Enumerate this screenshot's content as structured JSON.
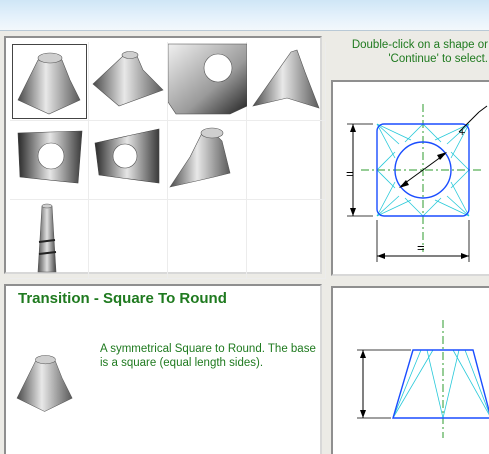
{
  "hint": {
    "line1": "Double-click on a shape or",
    "line2": "'Continue' to select."
  },
  "shapes": [
    {
      "name": "square-to-round",
      "selected": true
    },
    {
      "name": "rectangle-to-round",
      "selected": false
    },
    {
      "name": "square-plate-with-hole",
      "selected": false
    },
    {
      "name": "offset-transition",
      "selected": false
    },
    {
      "name": "rectangle-plate-with-hole",
      "selected": false
    },
    {
      "name": "tapered-plate-with-hole",
      "selected": false
    },
    {
      "name": "cone-transition",
      "selected": false
    },
    {
      "name": "segmented-column",
      "selected": false
    }
  ],
  "diagram": {
    "equal_mark_side": "=",
    "equal_mark_bottom": "=",
    "line_color": "#1a4dff",
    "fold_color": "#27c9d9",
    "centerline_color": "#2e9b2e"
  },
  "description": {
    "title": "Transition - Square To Round",
    "text": "A symmetrical Square to Round. The base is a square (equal length sides)."
  },
  "colors": {
    "accent_text": "#1f7a1f"
  }
}
